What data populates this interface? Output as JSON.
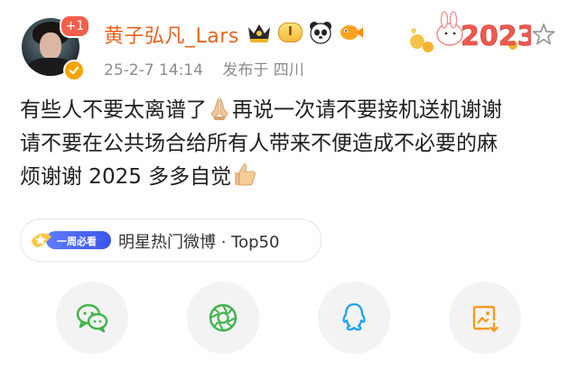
{
  "user": {
    "name": "黄子弘凡_Lars",
    "notification_badge": "+1",
    "level_badge": "I"
  },
  "post": {
    "timestamp": "25-2-7 14:14",
    "location": "发布于 四川",
    "text_line1": "有些人不要太离谱了",
    "text_line1_after_emoji": "再说一次请不要接机送机谢谢",
    "text_line2": "请不要在公共场合给所有人带来不便造成不必要的麻",
    "text_line3": "烦谢谢 2025 多多自觉"
  },
  "decoration": {
    "year_text": "2023"
  },
  "hot_tag": {
    "badge_label": "一周必看",
    "title": "明星热门微博 · Top50"
  },
  "share": {
    "icons": [
      "wechat-icon",
      "moments-icon",
      "qq-icon",
      "save-image-icon"
    ]
  },
  "colors": {
    "username": "#e8631c",
    "meta": "#8b8b8b",
    "action_bg": "#f3f3f3",
    "wechat": "#3fb34b",
    "moments": "#3fb34b",
    "qq": "#1fa2f0",
    "save": "#f59a23"
  }
}
